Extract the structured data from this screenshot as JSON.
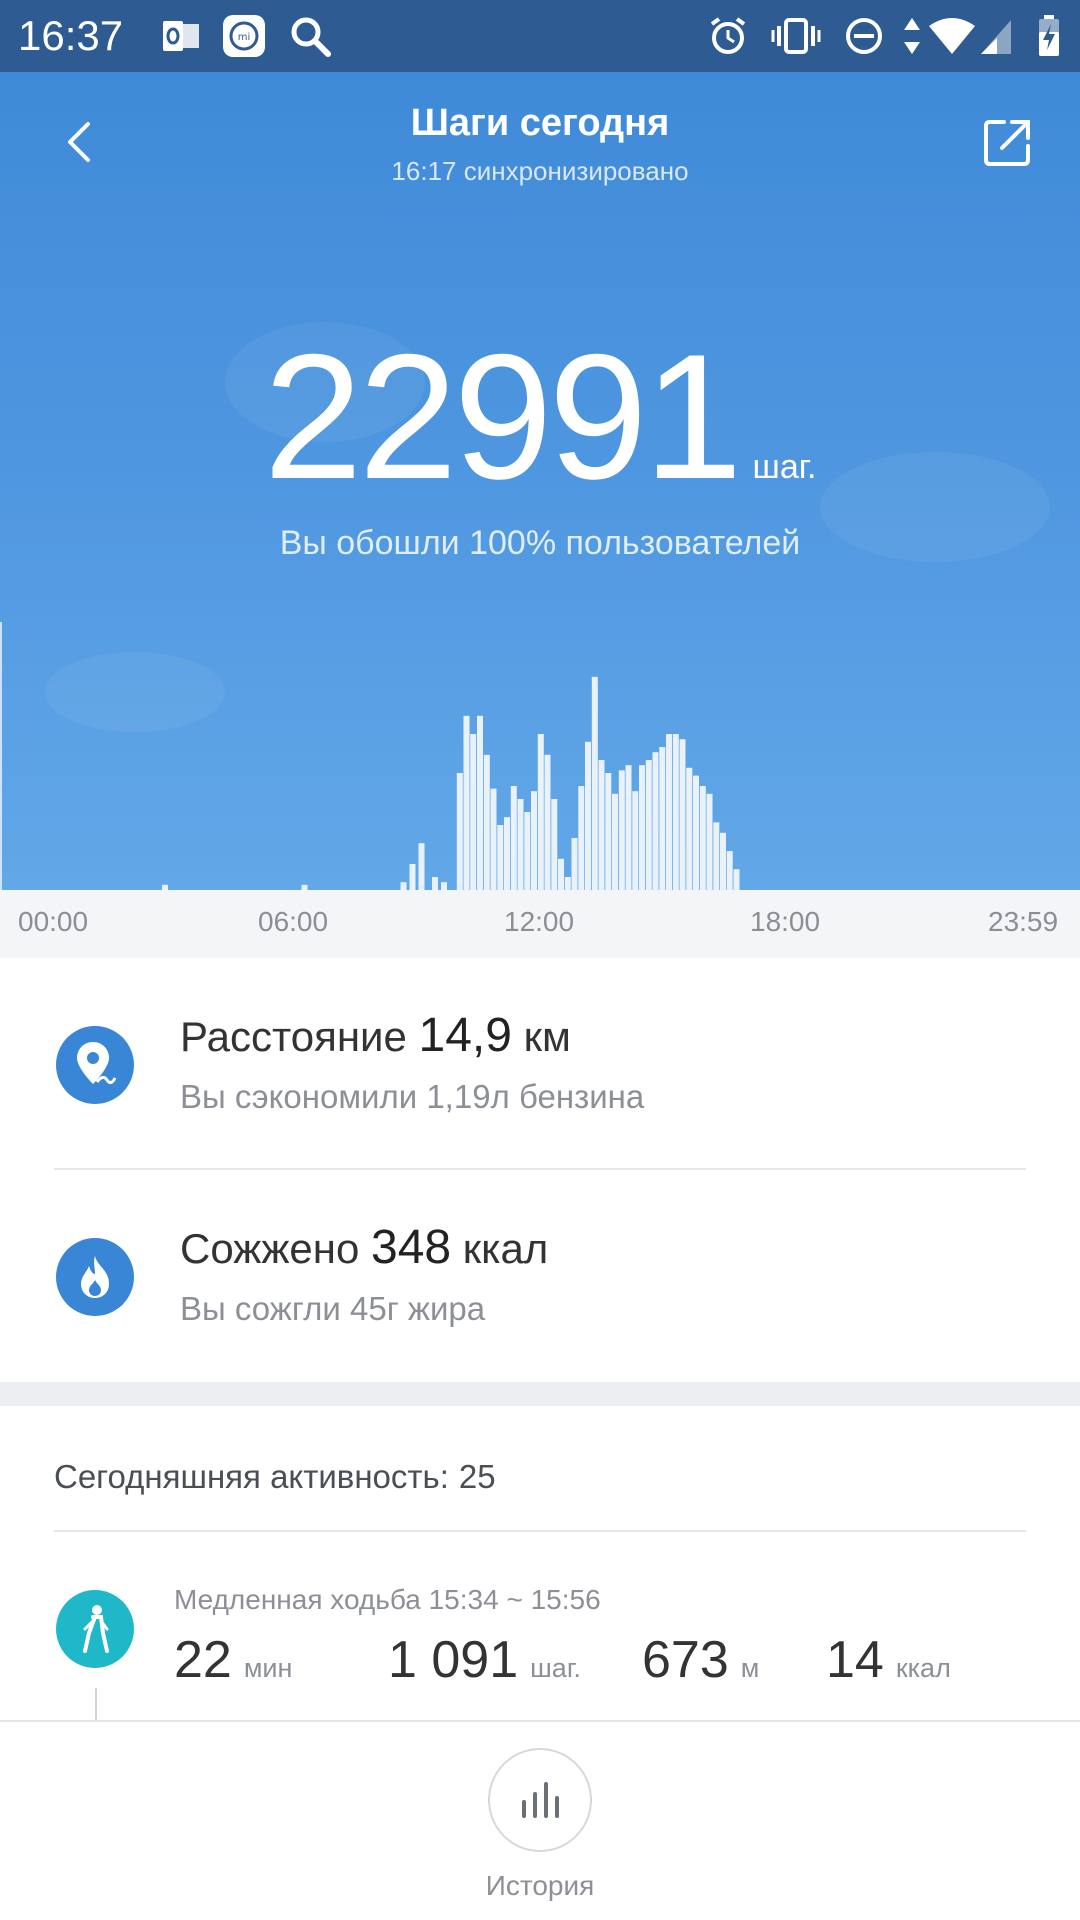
{
  "status_bar": {
    "time": "16:37",
    "left_icons": [
      "outlook-icon",
      "mi-fit-icon",
      "search-icon"
    ],
    "right_icons": [
      "alarm-icon",
      "vibrate-icon",
      "do-not-disturb-icon",
      "data-arrows-icon",
      "wifi-icon",
      "signal-icon",
      "battery-charging-icon"
    ]
  },
  "header": {
    "title": "Шаги сегодня",
    "sync_status": "16:17 синхронизировано",
    "back_icon": "chevron-left-icon",
    "share_icon": "share-icon"
  },
  "summary": {
    "steps": "22991",
    "steps_unit": "шаг.",
    "comparison": "Вы обошли 100% пользователей"
  },
  "chart_data": {
    "type": "bar",
    "x_range": [
      "00:00",
      "23:59"
    ],
    "tick_labels": [
      "00:00",
      "06:00",
      "12:00",
      "18:00",
      "23:59"
    ],
    "x_hours": [
      3.6,
      6.7,
      8.9,
      9.1,
      9.3,
      9.6,
      9.8,
      10.15,
      10.3,
      10.45,
      10.6,
      10.75,
      10.9,
      11.05,
      11.2,
      11.35,
      11.5,
      11.65,
      11.8,
      11.95,
      12.1,
      12.25,
      12.4,
      12.55,
      12.7,
      12.85,
      13.0,
      13.15,
      13.3,
      13.45,
      13.6,
      13.75,
      13.9,
      14.05,
      14.2,
      14.35,
      14.5,
      14.65,
      14.8,
      14.95,
      15.1,
      15.25,
      15.4,
      15.55,
      15.7,
      15.85,
      16.0,
      16.15,
      16.3
    ],
    "values": [
      2,
      2,
      3,
      10,
      18,
      5,
      3,
      45,
      67,
      60,
      67,
      52,
      39,
      25,
      28,
      40,
      35,
      30,
      38,
      60,
      52,
      35,
      12,
      5,
      20,
      40,
      57,
      82,
      50,
      45,
      37,
      46,
      48,
      38,
      48,
      50,
      53,
      55,
      60,
      60,
      58,
      47,
      44,
      40,
      37,
      26,
      22,
      15,
      8
    ],
    "ylim": [
      0,
      100
    ],
    "grid": false,
    "color": "#e9f2fb"
  },
  "stats": [
    {
      "icon": "location-pin-icon",
      "label": "Расстояние",
      "value": "14,9",
      "unit": "км",
      "sub": "Вы сэкономили 1,19л бензина",
      "color": "#3a86d6"
    },
    {
      "icon": "flame-icon",
      "label": "Сожжено",
      "value": "348",
      "unit": "ккал",
      "sub": "Вы сожгли 45г жира",
      "color": "#3a86d6"
    }
  ],
  "activity": {
    "title": "Сегодняшняя активность:",
    "count": "25",
    "item": {
      "icon": "walking-icon",
      "color": "#1fb8c9",
      "heading": "Медленная ходьба 15:34 ~ 15:56",
      "duration": "22",
      "duration_unit": "мин",
      "steps": "1 091",
      "steps_unit": "шаг.",
      "distance": "673",
      "distance_unit": "м",
      "calories": "14",
      "calories_unit": "ккал"
    }
  },
  "bottom_nav": {
    "history_icon": "bar-chart-icon",
    "history_label": "История"
  }
}
